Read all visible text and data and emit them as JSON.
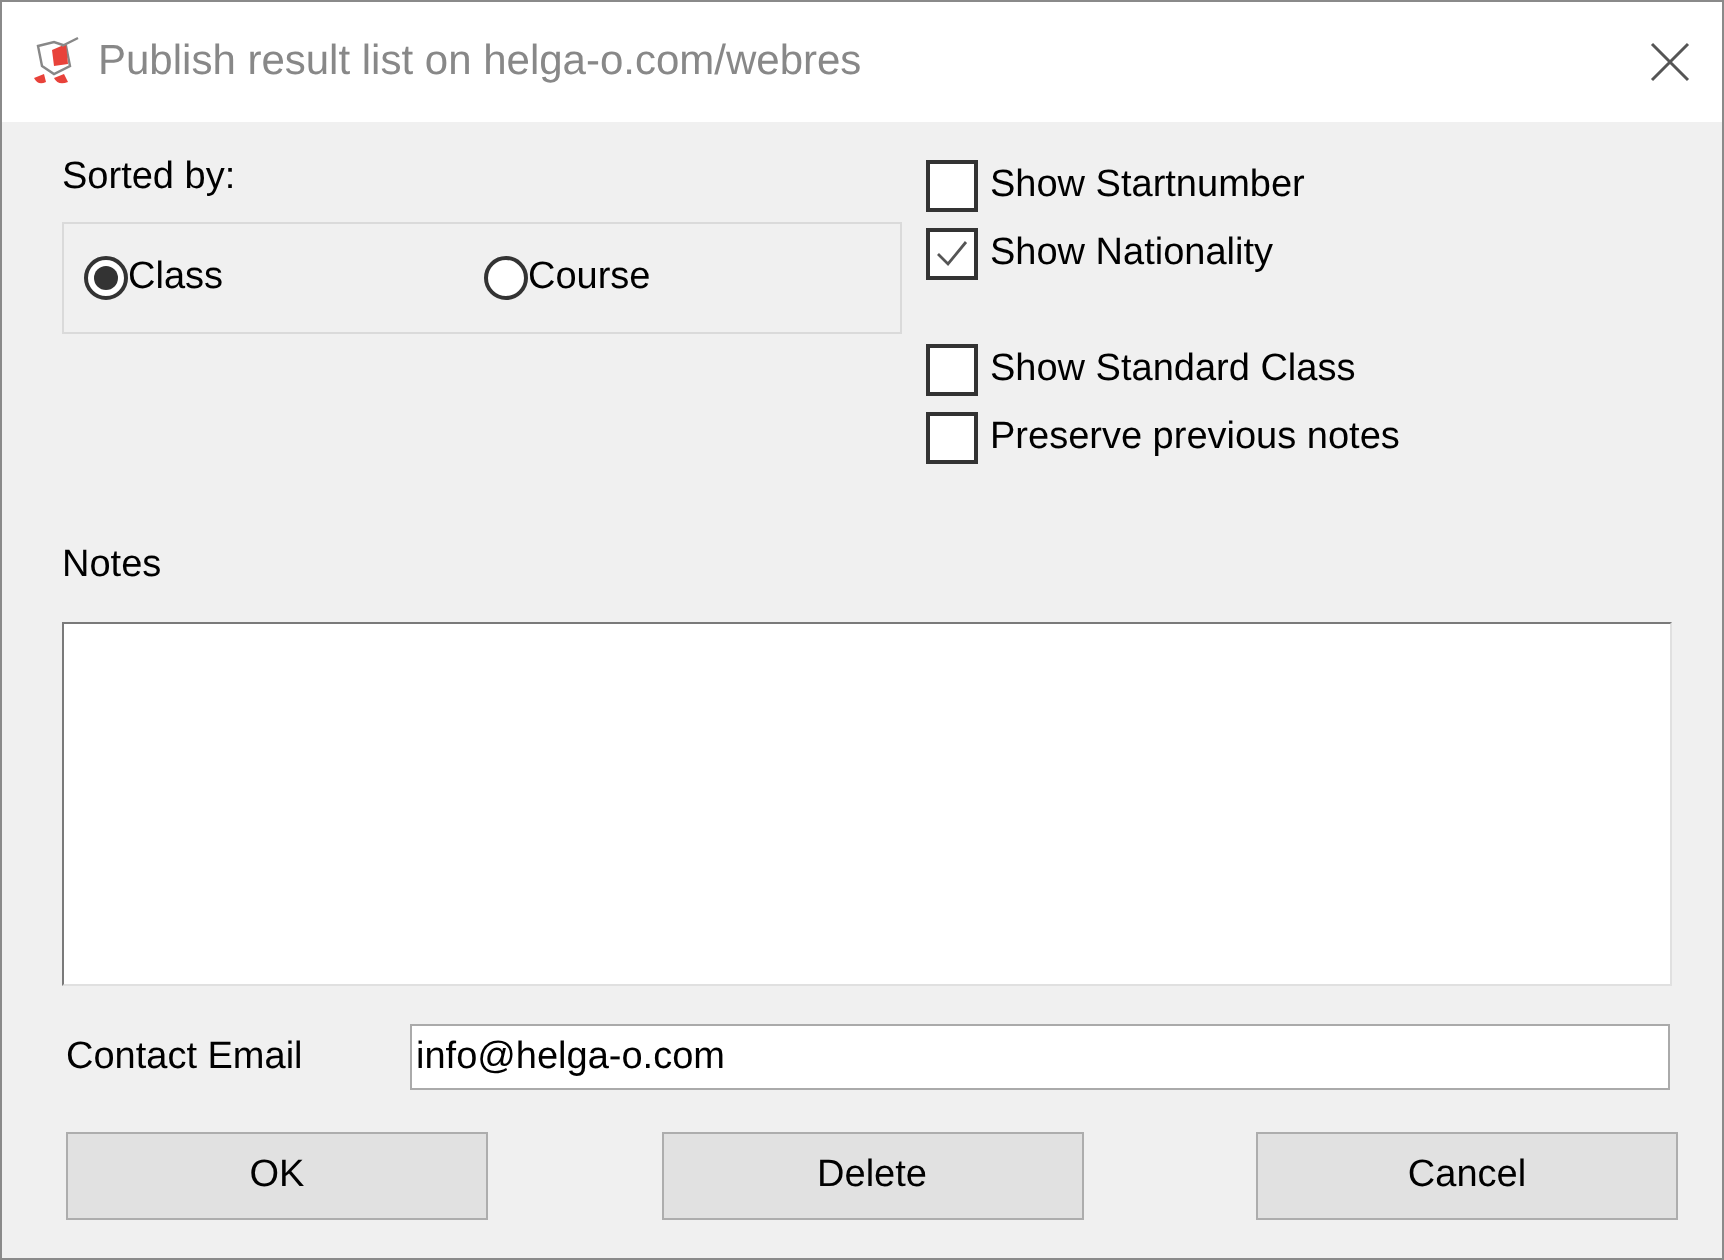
{
  "window": {
    "title": "Publish result list on helga-o.com/webres"
  },
  "sorted_by": {
    "label": "Sorted by:",
    "options": [
      {
        "label": "Class",
        "selected": true
      },
      {
        "label": "Course",
        "selected": false
      }
    ]
  },
  "checkbox_groups": [
    [
      {
        "label": "Show Startnumber",
        "checked": false
      },
      {
        "label": "Show Nationality",
        "checked": true
      }
    ],
    [
      {
        "label": "Show Standard Class",
        "checked": false
      },
      {
        "label": "Preserve previous notes",
        "checked": false
      }
    ]
  ],
  "notes": {
    "label": "Notes"
  },
  "contact_email": {
    "label": "Contact Email",
    "value": "info@helga-o.com"
  },
  "buttons": [
    "OK",
    "Delete",
    "Cancel"
  ]
}
